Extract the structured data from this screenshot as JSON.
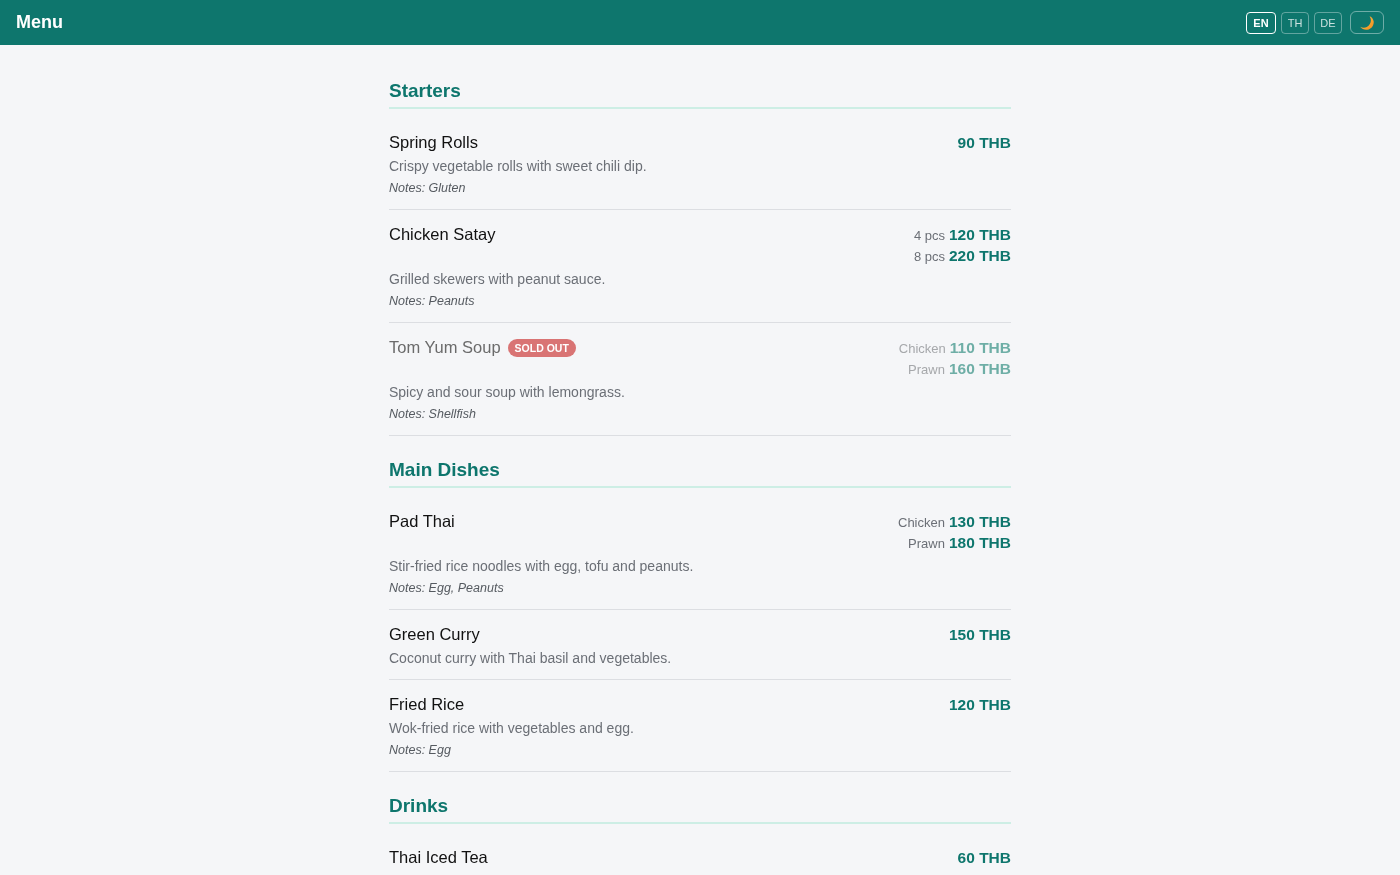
{
  "header": {
    "title": "Menu",
    "languages": [
      {
        "label": "EN",
        "selected": true
      },
      {
        "label": "TH",
        "selected": false
      },
      {
        "label": "DE",
        "selected": false
      }
    ]
  },
  "sections": [
    {
      "title": "Starters",
      "items": [
        {
          "name": "Spring Rolls",
          "sold_out": false,
          "prices": [
            {
              "price": "90 THB"
            }
          ],
          "description": "Crispy vegetable rolls with sweet chili dip.",
          "notes": "Notes: Gluten"
        },
        {
          "name": "Chicken Satay",
          "sold_out": false,
          "prices": [
            {
              "label": "4 pcs",
              "price": "120 THB"
            },
            {
              "label": "8 pcs",
              "price": "220 THB"
            }
          ],
          "description": "Grilled skewers with peanut sauce.",
          "notes": "Notes: Peanuts"
        },
        {
          "name": "Tom Yum Soup",
          "sold_out": true,
          "badge": "SOLD OUT",
          "prices": [
            {
              "label": "Chicken",
              "price": "110 THB"
            },
            {
              "label": "Prawn",
              "price": "160 THB"
            }
          ],
          "description": "Spicy and sour soup with lemongrass.",
          "notes": "Notes: Shellfish"
        }
      ]
    },
    {
      "title": "Main Dishes",
      "items": [
        {
          "name": "Pad Thai",
          "sold_out": false,
          "prices": [
            {
              "label": "Chicken",
              "price": "130 THB"
            },
            {
              "label": "Prawn",
              "price": "180 THB"
            }
          ],
          "description": "Stir-fried rice noodles with egg, tofu and peanuts.",
          "notes": "Notes: Egg, Peanuts"
        },
        {
          "name": "Green Curry",
          "sold_out": false,
          "prices": [
            {
              "price": "150 THB"
            }
          ],
          "description": "Coconut curry with Thai basil and vegetables."
        },
        {
          "name": "Fried Rice",
          "sold_out": false,
          "prices": [
            {
              "price": "120 THB"
            }
          ],
          "description": "Wok-fried rice with vegetables and egg.",
          "notes": "Notes: Egg"
        }
      ]
    },
    {
      "title": "Drinks",
      "items": [
        {
          "name": "Thai Iced Tea",
          "sold_out": false,
          "prices": [
            {
              "price": "60 THB"
            }
          ]
        }
      ]
    }
  ]
}
